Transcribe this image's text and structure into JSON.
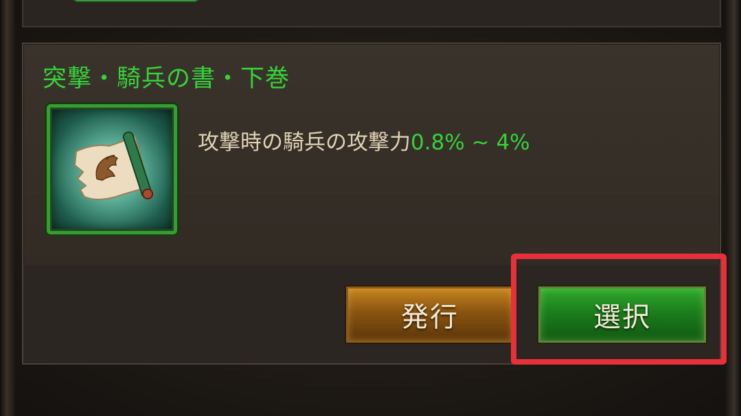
{
  "item": {
    "title": "突撃・騎兵の書・下巻",
    "description_text": "攻撃時の騎兵の攻撃力",
    "description_value": "0.8% ~ 4%",
    "icon": "scroll-icon"
  },
  "buttons": {
    "issue_label": "発行",
    "select_label": "選択"
  },
  "colors": {
    "title_green": "#35d33a",
    "value_green": "#35d33a",
    "description_text": "#e0d2b4",
    "issue_button": "#b07418",
    "select_button": "#1f8a1f",
    "highlight_red": "#e8303a"
  }
}
